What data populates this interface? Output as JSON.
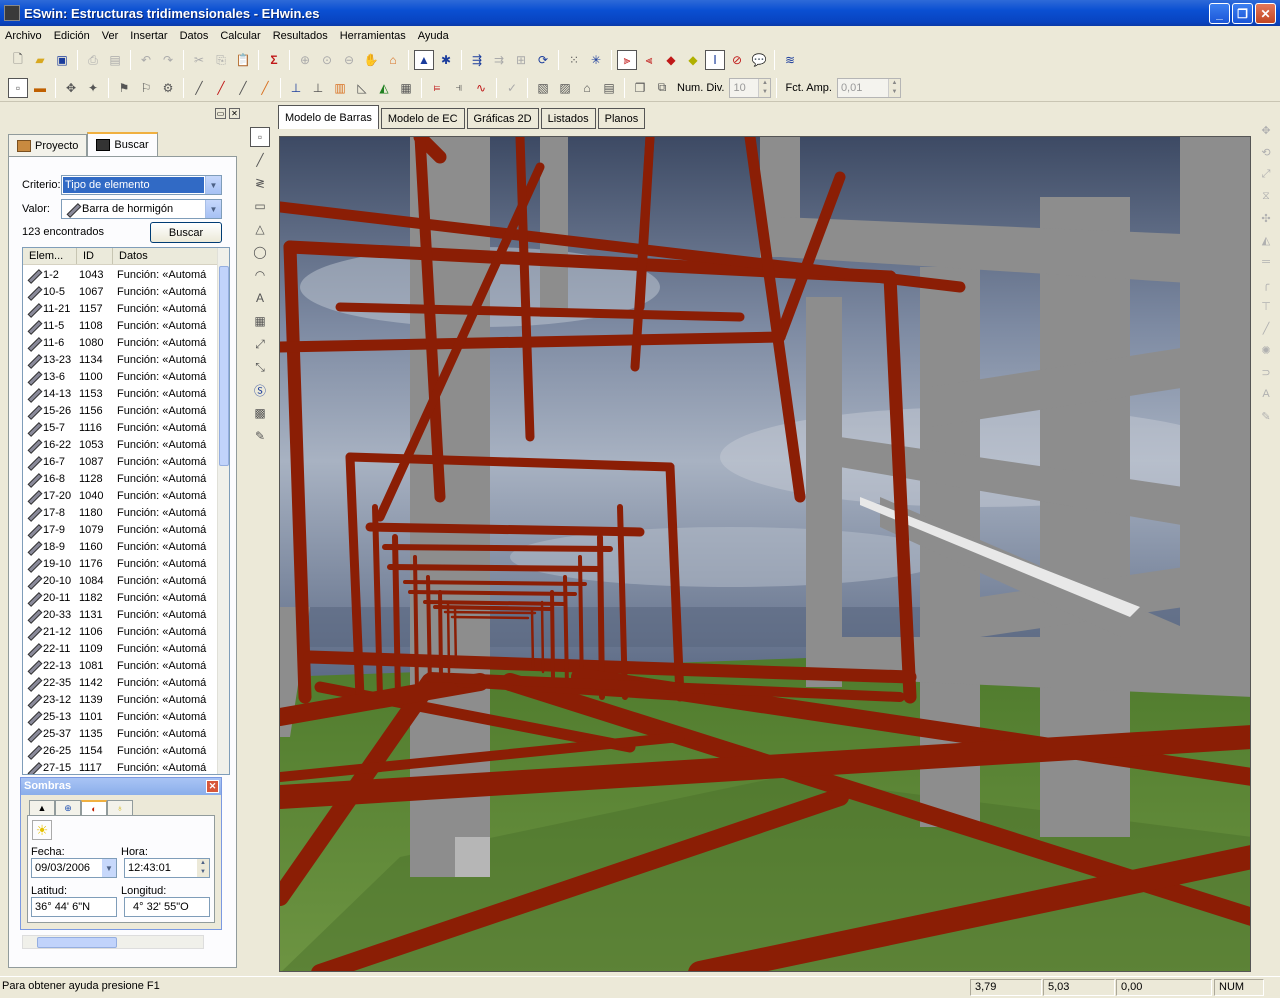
{
  "window": {
    "title": "ESwin: Estructuras tridimensionales - EHwin.es"
  },
  "menu": [
    "Archivo",
    "Edición",
    "Ver",
    "Insertar",
    "Datos",
    "Calcular",
    "Resultados",
    "Herramientas",
    "Ayuda"
  ],
  "toolbar2": {
    "num_div_label": "Num. Div.",
    "num_div_value": "10",
    "fct_amp_label": "Fct. Amp.",
    "fct_amp_value": "0,01"
  },
  "panel": {
    "tabs": [
      "Proyecto",
      "Buscar"
    ],
    "criterio_label": "Criterio:",
    "criterio_value": "Tipo de elemento",
    "valor_label": "Valor:",
    "valor_value": "Barra de hormigón",
    "count_text": "123 encontrados",
    "buscar_button": "Buscar",
    "columns": [
      "Elem...",
      "ID",
      "Datos"
    ],
    "rows": [
      {
        "elem": "1-2",
        "id": "1043",
        "datos": "Función: «Automá"
      },
      {
        "elem": "10-5",
        "id": "1067",
        "datos": "Función: «Automá"
      },
      {
        "elem": "11-21",
        "id": "1157",
        "datos": "Función: «Automá"
      },
      {
        "elem": "11-5",
        "id": "1108",
        "datos": "Función: «Automá"
      },
      {
        "elem": "11-6",
        "id": "1080",
        "datos": "Función: «Automá"
      },
      {
        "elem": "13-23",
        "id": "1134",
        "datos": "Función: «Automá"
      },
      {
        "elem": "13-6",
        "id": "1100",
        "datos": "Función: «Automá"
      },
      {
        "elem": "14-13",
        "id": "1153",
        "datos": "Función: «Automá"
      },
      {
        "elem": "15-26",
        "id": "1156",
        "datos": "Función: «Automá"
      },
      {
        "elem": "15-7",
        "id": "1116",
        "datos": "Función: «Automá"
      },
      {
        "elem": "16-22",
        "id": "1053",
        "datos": "Función: «Automá"
      },
      {
        "elem": "16-7",
        "id": "1087",
        "datos": "Función: «Automá"
      },
      {
        "elem": "16-8",
        "id": "1128",
        "datos": "Función: «Automá"
      },
      {
        "elem": "17-20",
        "id": "1040",
        "datos": "Función: «Automá"
      },
      {
        "elem": "17-8",
        "id": "1180",
        "datos": "Función: «Automá"
      },
      {
        "elem": "17-9",
        "id": "1079",
        "datos": "Función: «Automá"
      },
      {
        "elem": "18-9",
        "id": "1160",
        "datos": "Función: «Automá"
      },
      {
        "elem": "19-10",
        "id": "1176",
        "datos": "Función: «Automá"
      },
      {
        "elem": "20-10",
        "id": "1084",
        "datos": "Función: «Automá"
      },
      {
        "elem": "20-11",
        "id": "1182",
        "datos": "Función: «Automá"
      },
      {
        "elem": "20-33",
        "id": "1131",
        "datos": "Función: «Automá"
      },
      {
        "elem": "21-12",
        "id": "1106",
        "datos": "Función: «Automá"
      },
      {
        "elem": "22-11",
        "id": "1109",
        "datos": "Función: «Automá"
      },
      {
        "elem": "22-13",
        "id": "1081",
        "datos": "Función: «Automá"
      },
      {
        "elem": "22-35",
        "id": "1142",
        "datos": "Función: «Automá"
      },
      {
        "elem": "23-12",
        "id": "1139",
        "datos": "Función: «Automá"
      },
      {
        "elem": "25-13",
        "id": "1101",
        "datos": "Función: «Automá"
      },
      {
        "elem": "25-37",
        "id": "1135",
        "datos": "Función: «Automá"
      },
      {
        "elem": "26-25",
        "id": "1154",
        "datos": "Función: «Automá"
      },
      {
        "elem": "27-15",
        "id": "1117",
        "datos": "Función: «Automá"
      }
    ]
  },
  "sombras": {
    "title": "Sombras",
    "fecha_label": "Fecha:",
    "fecha_value": "09/03/2006",
    "hora_label": "Hora:",
    "hora_value": "12:43:01",
    "latitud_label": "Latitud:",
    "latitud_value": "36° 44'  6\"N",
    "longitud_label": "Longitud:",
    "longitud_value": "4° 32' 55\"O"
  },
  "doc_tabs": [
    "Modelo de Barras",
    "Modelo de EC",
    "Gráficas 2D",
    "Listados",
    "Planos"
  ],
  "status": {
    "message": "Para obtener ayuda presione F1",
    "x": "3,79",
    "y": "5,03",
    "z": "0,00",
    "mode": "NUM"
  },
  "colors": {
    "bars": "#8b1e05",
    "sky": "#7a8aa0",
    "ground": "#5e8a3a",
    "columns": "#8d8d8d"
  }
}
